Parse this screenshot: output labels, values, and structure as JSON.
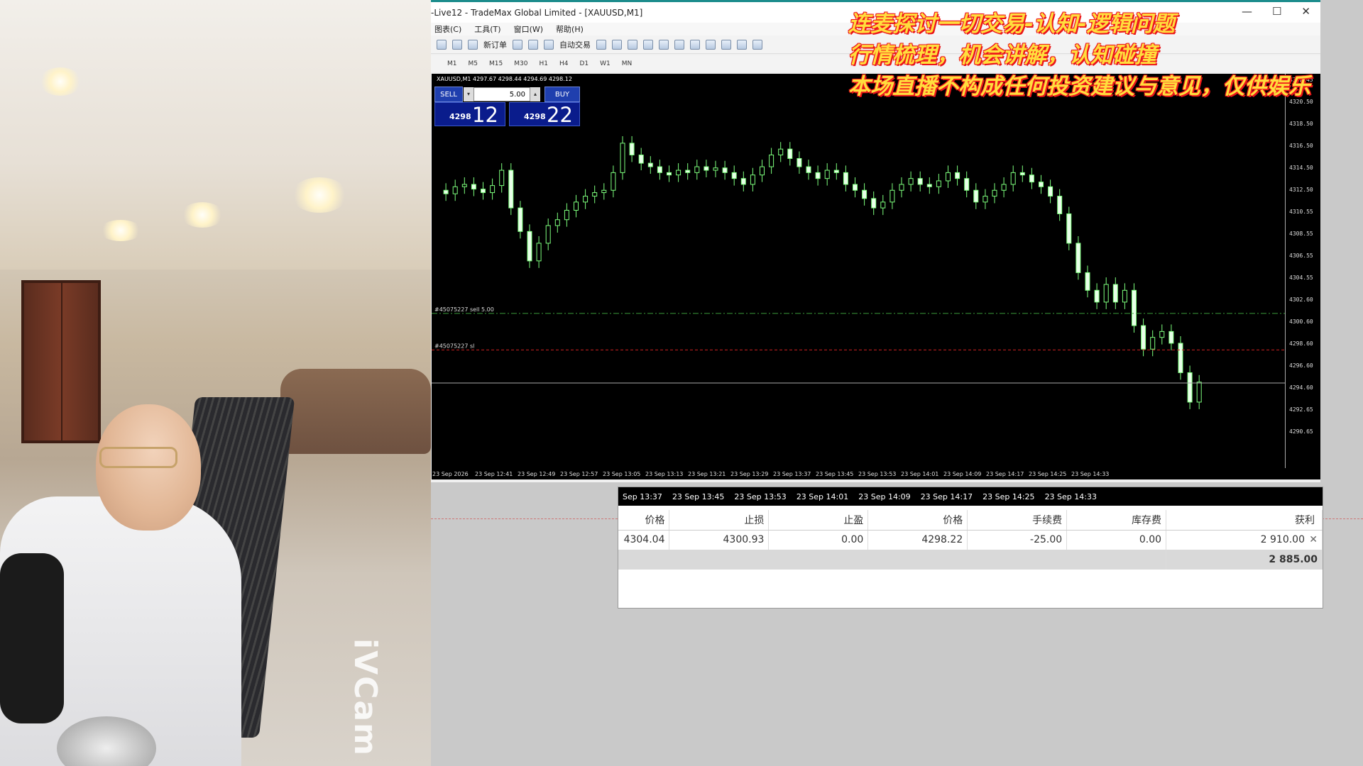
{
  "window": {
    "title": "-Live12 - TradeMax Global Limited - [XAUUSD,M1]"
  },
  "menu": [
    "图表(C)",
    "工具(T)",
    "窗口(W)",
    "帮助(H)"
  ],
  "toolbar": {
    "new_order": "新订单",
    "auto_trade": "自动交易"
  },
  "timeframes": [
    "M1",
    "M5",
    "M15",
    "M30",
    "H1",
    "H4",
    "D1",
    "W1",
    "MN"
  ],
  "chart": {
    "symbol_line": "XAUUSD,M1  4297.67 4298.44 4294.69 4298.12",
    "sell_label": "SELL",
    "buy_label": "BUY",
    "lot": "5.00",
    "sell_small": "4298",
    "sell_big": "12",
    "buy_small": "4298",
    "buy_big": "22",
    "order_label": "#45075227 sell 5.00",
    "sl_label": "#45075227 sl",
    "price_tag": "4298.12",
    "y_ticks": [
      "4322.45",
      "4320.50",
      "4318.50",
      "4316.50",
      "4314.50",
      "4312.50",
      "4310.55",
      "4308.55",
      "4306.55",
      "4304.55",
      "4302.60",
      "4300.60",
      "4298.60",
      "4296.60",
      "4294.60",
      "4292.65",
      "4290.65"
    ],
    "x_ticks": [
      "23 Sep 2026",
      "23 Sep 12:41",
      "23 Sep 12:49",
      "23 Sep 12:57",
      "23 Sep 13:05",
      "23 Sep 13:13",
      "23 Sep 13:21",
      "23 Sep 13:29",
      "23 Sep 13:37",
      "23 Sep 13:45",
      "23 Sep 13:53",
      "23 Sep 14:01",
      "23 Sep 14:09",
      "23 Sep 14:17",
      "23 Sep 14:25",
      "23 Sep 14:33"
    ]
  },
  "overlay": {
    "line1": "连麦探讨一切交易-认知-逻辑问题",
    "line2": "行情梳理，机会讲解，认知碰撞",
    "line3": "本场直播不构成任何投资建议与意见，仅供娱乐"
  },
  "watermark": "iVCam",
  "terminal": {
    "times": [
      "Sep 13:37",
      "23 Sep 13:45",
      "23 Sep 13:53",
      "23 Sep 14:01",
      "23 Sep 14:09",
      "23 Sep 14:17",
      "23 Sep 14:25",
      "23 Sep 14:33"
    ],
    "headers": [
      "价格",
      "止损",
      "止盈",
      "价格",
      "手续费",
      "库存费",
      "获利"
    ],
    "row": [
      "4304.04",
      "4300.93",
      "0.00",
      "4298.22",
      "-25.00",
      "0.00",
      "2 910.00"
    ],
    "total": "2 885.00"
  }
}
